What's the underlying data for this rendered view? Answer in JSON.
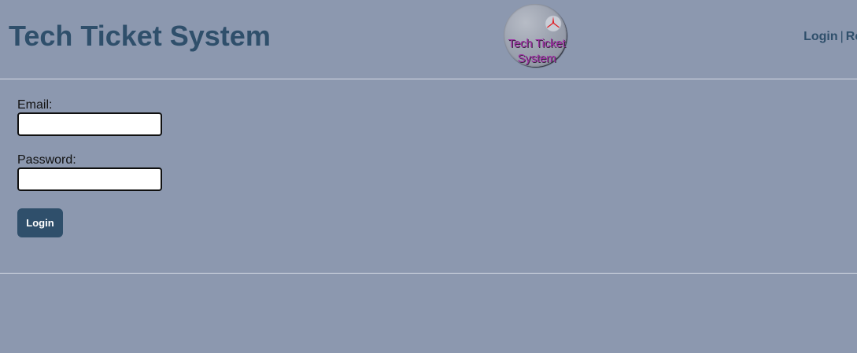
{
  "header": {
    "site_title": "Tech Ticket System",
    "logo": {
      "icon": "red-tristar-icon",
      "text_line1": "Tech Ticket",
      "text_line2": "System"
    },
    "nav": {
      "login_label": "Login",
      "separator": "|",
      "register_label": "Reg"
    }
  },
  "login_form": {
    "email_label": "Email:",
    "email_value": "",
    "email_placeholder": "",
    "password_label": "Password:",
    "password_value": "",
    "password_placeholder": "",
    "submit_label": "Login"
  },
  "colors": {
    "page_background": "#8c98af",
    "title_and_button": "#2f4f6b",
    "logo_text": "#a02fa6",
    "logo_star": "#e01d24",
    "divider": "#d6dbe5"
  }
}
